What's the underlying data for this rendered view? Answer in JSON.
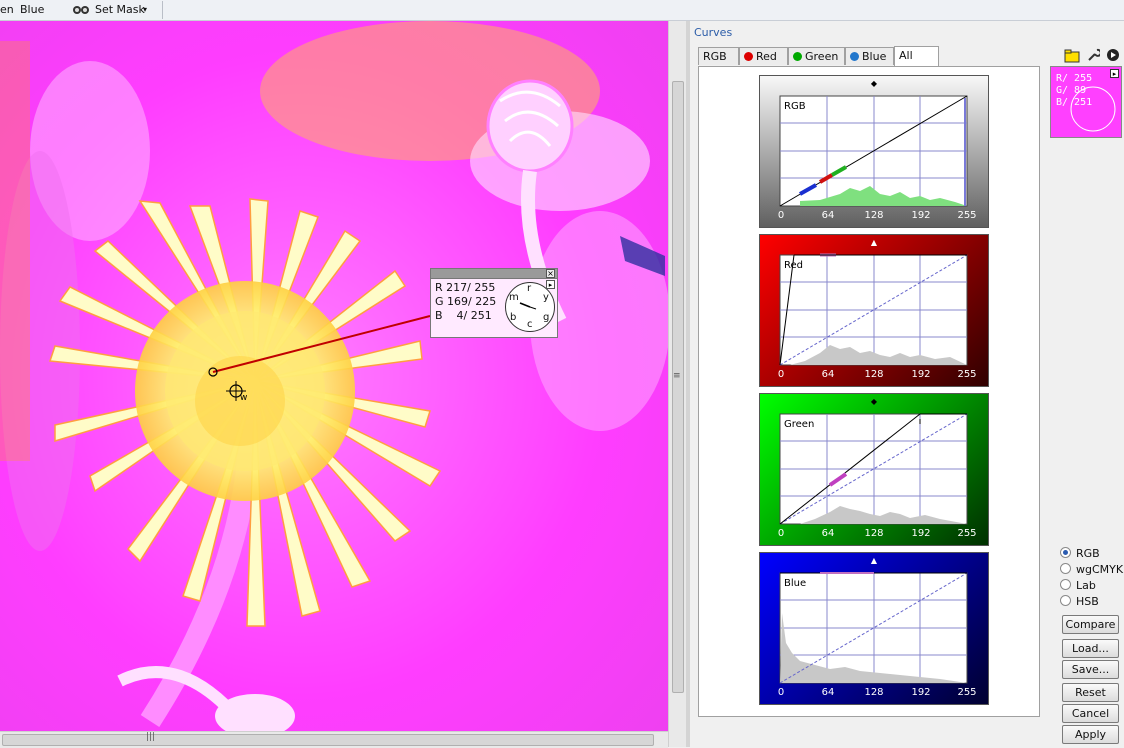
{
  "toolbar": {
    "channel_left": "en",
    "channel_blue": "Blue",
    "set_mask": "Set Mask"
  },
  "panel": {
    "title": "Curves",
    "tabs": [
      {
        "label": "RGB"
      },
      {
        "label": "Red"
      },
      {
        "label": "Green"
      },
      {
        "label": "Blue"
      },
      {
        "label": "All"
      }
    ],
    "active_tab": "All"
  },
  "curves": [
    {
      "label": "RGB",
      "ticks": [
        "0",
        "64",
        "128",
        "192",
        "255"
      ]
    },
    {
      "label": "Red",
      "ticks": [
        "0",
        "64",
        "128",
        "192",
        "255"
      ]
    },
    {
      "label": "Green",
      "ticks": [
        "0",
        "64",
        "128",
        "192",
        "255"
      ]
    },
    {
      "label": "Blue",
      "ticks": [
        "0",
        "64",
        "128",
        "192",
        "255"
      ]
    }
  ],
  "swatch": {
    "r": "R/ 255",
    "g": "G/  89",
    "b": "B/ 251"
  },
  "color_modes": [
    {
      "label": "RGB",
      "selected": true
    },
    {
      "label": "wgCMYK",
      "selected": false
    },
    {
      "label": "Lab",
      "selected": false
    },
    {
      "label": "HSB",
      "selected": false
    }
  ],
  "buttons": {
    "compare": "Compare",
    "load": "Load...",
    "save": "Save...",
    "reset": "Reset",
    "cancel": "Cancel",
    "apply": "Apply"
  },
  "readout": {
    "r": "R 217/ 255",
    "g": "G 169/ 225",
    "b": "B    4/ 251",
    "dial": {
      "r": "r",
      "y": "y",
      "g": "g",
      "c": "c",
      "b": "b",
      "m": "m"
    }
  },
  "cursor_label": "w",
  "colors": {
    "image_magenta": "#ff3dff",
    "flower_yellow": "#ffff60",
    "panel_title": "#2b5ca8",
    "swatch": "#ff40ff"
  }
}
